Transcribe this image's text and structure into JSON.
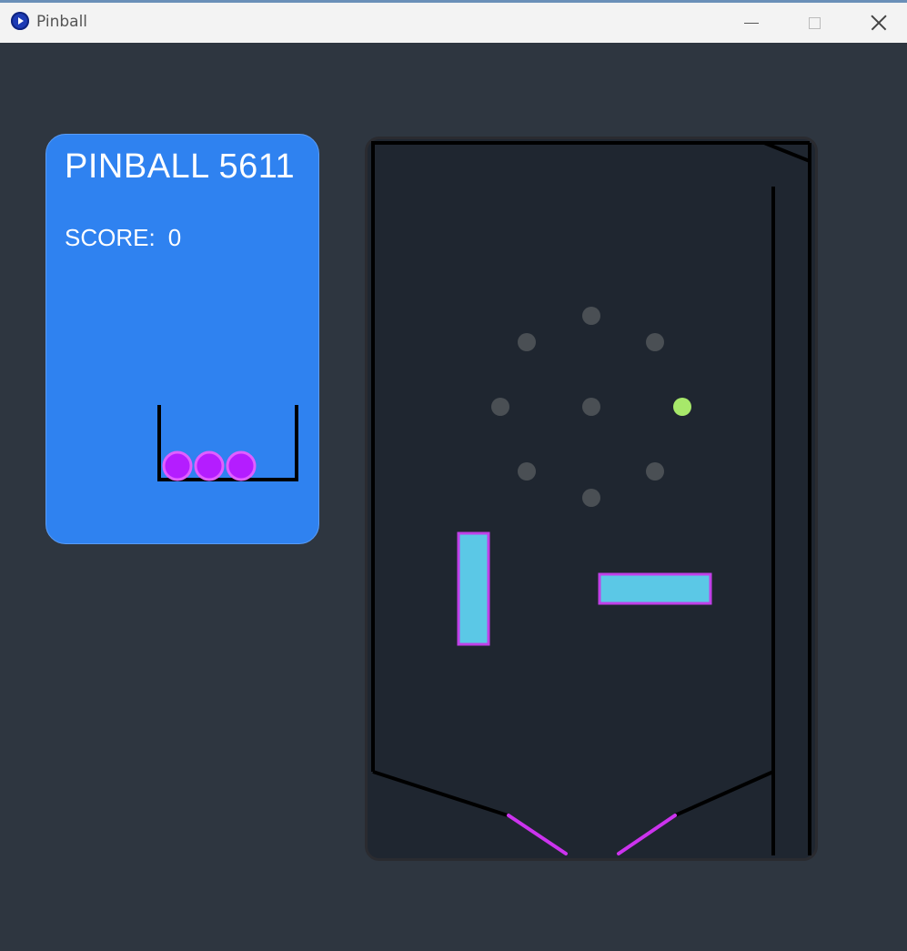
{
  "window": {
    "title": "Pinball",
    "icon": "app-icon",
    "controls": [
      "minimize-icon",
      "maximize-icon",
      "close-icon"
    ]
  },
  "scoreboard": {
    "title": "PINBALL 5611",
    "score_label": "SCORE:",
    "score_value": "0",
    "balls_remaining": 3
  },
  "playfield": {
    "ball_color": "#a7e86a",
    "bumper_color": "#4a4f54",
    "flipper_color": "#cc33ee",
    "obstacle_fill": "#5bc8e6",
    "obstacle_stroke": "#c040e8",
    "wall_color": "#000000",
    "reserve_ball_color": "#b41dff"
  },
  "colors": {
    "background": "#2e3640",
    "panel": "#2f82f0",
    "playfield_bg": "#1f2630"
  }
}
